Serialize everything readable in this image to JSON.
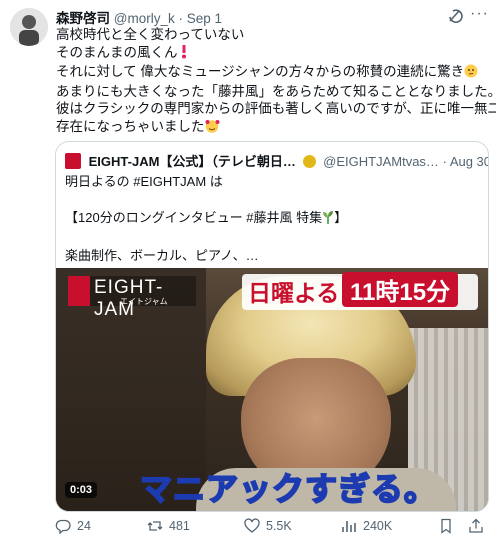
{
  "tweet": {
    "display_name": "森野啓司",
    "handle": "@morly_k",
    "separator": "·",
    "date": "Sep 1",
    "lines": [
      "高校時代と全く変わっていない",
      "そのまんまの風くん",
      "それに対して 偉大なミュージシャンの方々からの称賛の連続に驚き",
      "あまりにも大きくなった「藤井風」をあらためて知ることとなりました。",
      "彼はクラシックの専門家からの評価も著しく高いのですが、正に唯一無二の",
      "存在になっちゃいました"
    ],
    "emojis": [
      "heart-exclamation",
      "thinking-face",
      "smiling-face-with-hearts"
    ]
  },
  "quote": {
    "display_name": "EIGHT-JAM【公式】（テレビ朝日…",
    "handle": "@EIGHTJAMtvas…",
    "separator": "·",
    "date": "Aug 30",
    "line1": "明日よるの #EIGHTJAM は",
    "line2": "【120分のロングインタビュー #藤井風 特集",
    "line3": "楽曲制作、ボーカル、ピアノ、…",
    "video": {
      "logo_text": "EIGHT-JAM",
      "logo_sub": "エイトジャム",
      "day_text": "日曜よる",
      "time_text": "11時15分",
      "caption": "マニアックすぎる。",
      "duration": "0:03"
    }
  },
  "actions": {
    "replies": "24",
    "reposts": "481",
    "likes": "5.5K",
    "views": "240K"
  },
  "colors": {
    "accent": "#1d9bf0",
    "muted": "#536471",
    "border": "#cfd9de",
    "brand_red": "#c8102e"
  }
}
